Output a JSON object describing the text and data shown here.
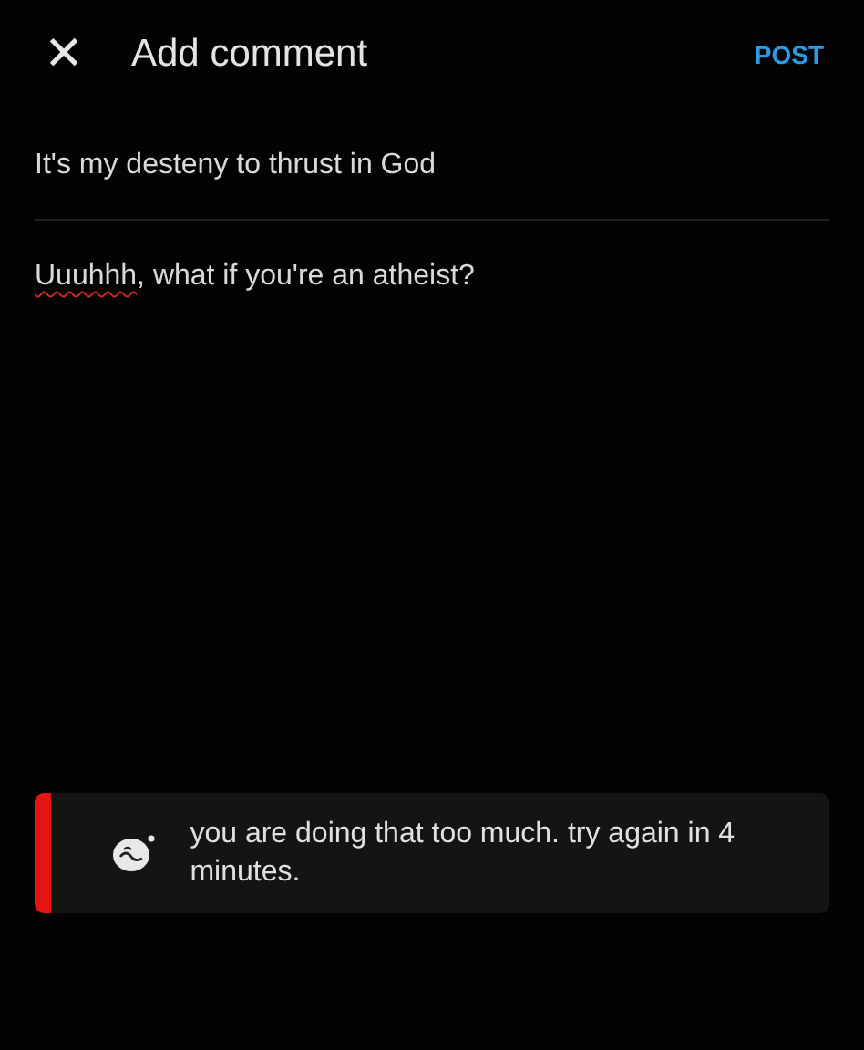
{
  "header": {
    "close": "✕",
    "title": "Add comment",
    "action": "POST"
  },
  "parent_comment": "It's my desteny to thrust in God",
  "reply": {
    "parts": [
      {
        "text": "Uuuhhh",
        "misspelled": true
      },
      {
        "text": ", what if you're an atheist?",
        "misspelled": false
      }
    ]
  },
  "toast": {
    "kind": "error",
    "message": "you are doing that too much. try again in 4 minutes."
  }
}
